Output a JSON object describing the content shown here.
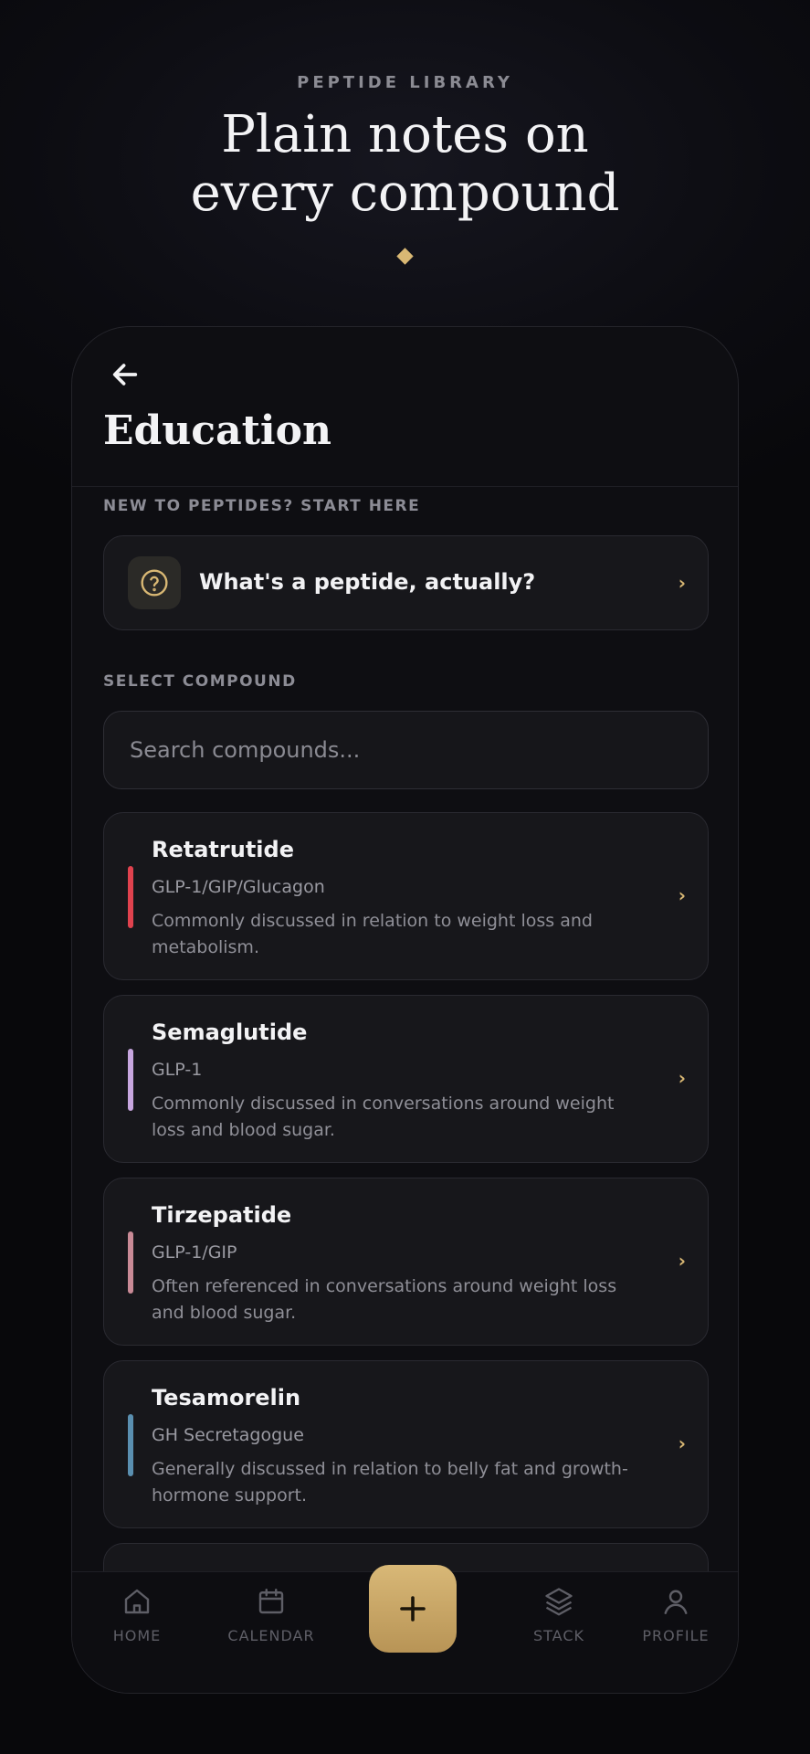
{
  "hero": {
    "eyebrow": "PEPTIDE LIBRARY",
    "headline_line1": "Plain notes on",
    "headline_line2": "every compound"
  },
  "header": {
    "back_icon": "arrow-left-icon",
    "title": "Education"
  },
  "intro": {
    "label": "NEW TO PEPTIDES? START HERE",
    "icon": "question-circle-icon",
    "text": "What's a peptide, actually?"
  },
  "compounds": {
    "label": "SELECT COMPOUND",
    "search_placeholder": "Search compounds...",
    "items": [
      {
        "name": "Retatrutide",
        "class": "GLP-1/GIP/Glucagon",
        "description": "Commonly discussed in relation to weight loss and metabolism.",
        "accent": "#e0424e"
      },
      {
        "name": "Semaglutide",
        "class": "GLP-1",
        "description": "Commonly discussed in conversations around weight loss and blood sugar.",
        "accent": "#c7a6df"
      },
      {
        "name": "Tirzepatide",
        "class": "GLP-1/GIP",
        "description": "Often referenced in conversations around weight loss and blood sugar.",
        "accent": "#c98a96"
      },
      {
        "name": "Tesamorelin",
        "class": "GH Secretagogue",
        "description": "Generally discussed in relation to belly fat and growth-hormone support.",
        "accent": "#5a8fb0"
      }
    ],
    "chevron": "›"
  },
  "nav": {
    "home": "HOME",
    "calendar": "CALENDAR",
    "stack": "STACK",
    "profile": "PROFILE"
  },
  "colors": {
    "accent_gold": "#d9b874",
    "background": "#0e0e12",
    "card": "#17171b"
  }
}
